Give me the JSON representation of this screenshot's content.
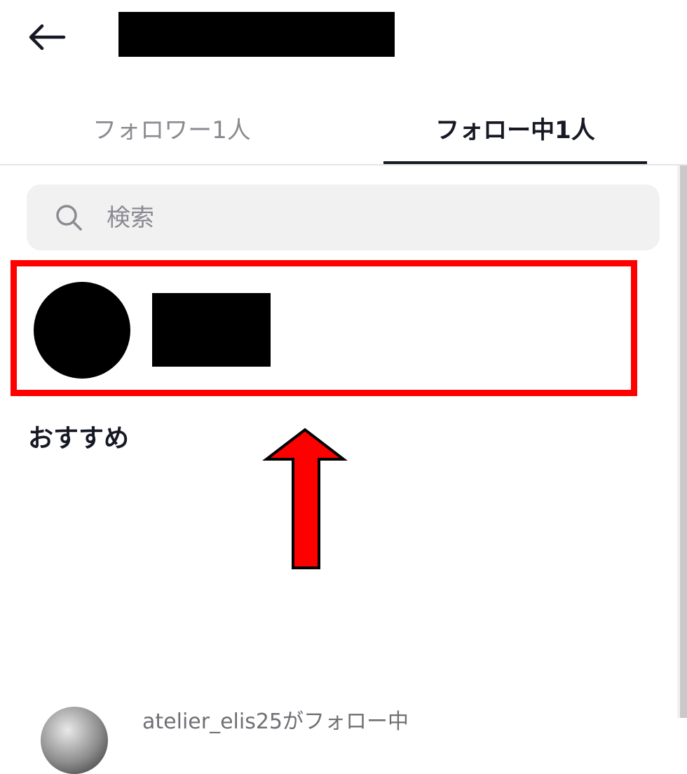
{
  "header": {
    "back_icon": "arrow-left-icon"
  },
  "tabs": [
    {
      "label": "フォロワー1人",
      "active": false
    },
    {
      "label": "フォロー中1人",
      "active": true
    }
  ],
  "search": {
    "placeholder": "検索",
    "icon": "search-icon"
  },
  "section": {
    "title": "おすすめ"
  },
  "suggestion": {
    "text": "atelier_elis25がフォロー中"
  },
  "annotation": {
    "highlight_color": "#ff0000",
    "arrow_color": "#ff0000"
  }
}
